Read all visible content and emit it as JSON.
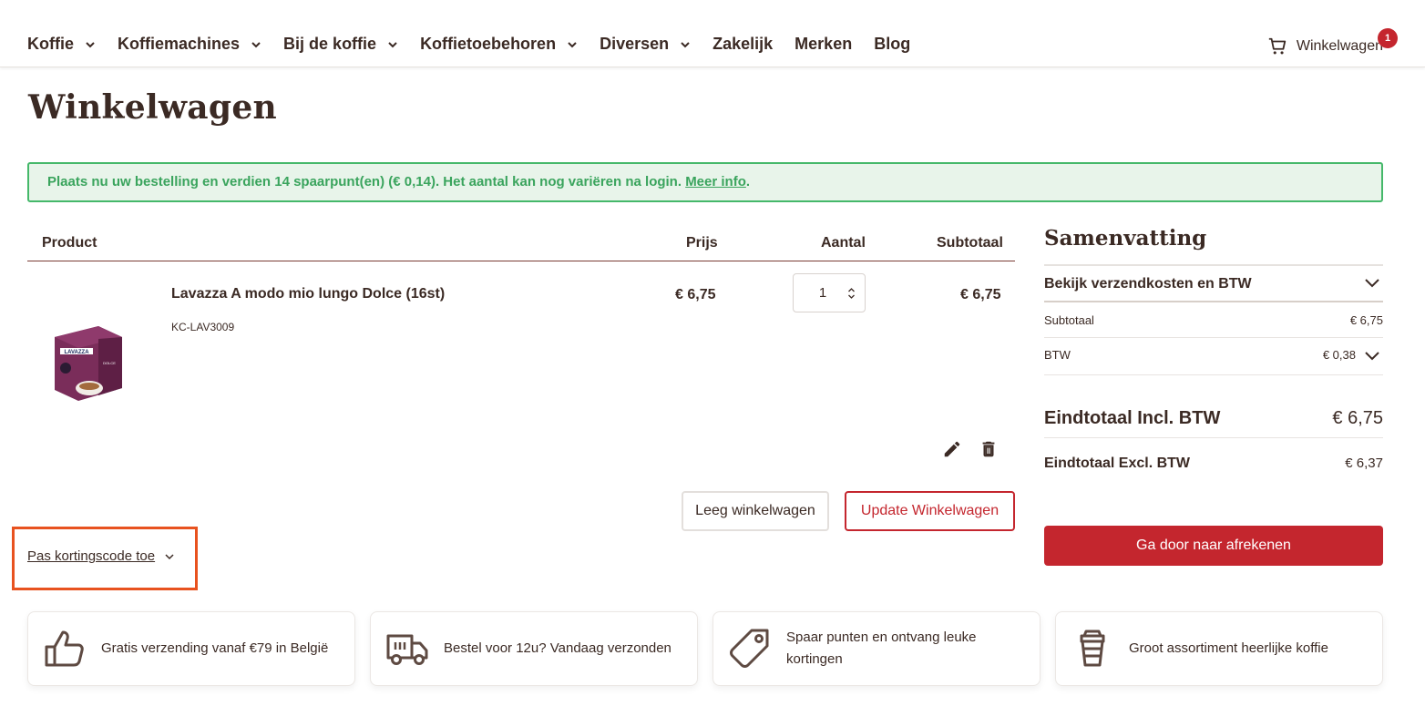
{
  "nav": {
    "items": [
      {
        "label": "Koffie",
        "has_dropdown": true
      },
      {
        "label": "Koffiemachines",
        "has_dropdown": true
      },
      {
        "label": "Bij de koffie",
        "has_dropdown": true
      },
      {
        "label": "Koffietoebehoren",
        "has_dropdown": true
      },
      {
        "label": "Diversen",
        "has_dropdown": true
      },
      {
        "label": "Zakelijk",
        "has_dropdown": false
      },
      {
        "label": "Merken",
        "has_dropdown": false
      },
      {
        "label": "Blog",
        "has_dropdown": false
      }
    ],
    "cart_label": "Winkelwagen",
    "cart_count": "1",
    "cart_icon": "shopping-cart-icon"
  },
  "page": {
    "title": "Winkelwagen"
  },
  "notice": {
    "text": "Plaats nu uw bestelling en verdien 14 spaarpunt(en) (€ 0,14). Het aantal kan nog variëren na login.",
    "link": "Meer info",
    "after": "."
  },
  "table": {
    "headers": {
      "product": "Product",
      "price": "Prijs",
      "qty": "Aantal",
      "subtotal": "Subtotaal"
    },
    "items": [
      {
        "name": "Lavazza A modo mio lungo Dolce (16st)",
        "sku": "KC-LAV3009",
        "price": "€ 6,75",
        "qty": "1",
        "subtotal": "€ 6,75",
        "image_brand": "LAVAZZA",
        "image_variant": "DOLCE"
      }
    ]
  },
  "actions": {
    "clear": "Leeg winkelwagen",
    "update": "Update Winkelwagen",
    "coupon": "Pas kortingscode toe"
  },
  "summary": {
    "title": "Samenvatting",
    "toggle": "Bekijk verzendkosten en BTW",
    "subtotal_label": "Subtotaal",
    "subtotal_value": "€ 6,75",
    "btw_label": "BTW",
    "btw_value": "€ 0,38",
    "total_incl_label": "Eindtotaal Incl. BTW",
    "total_incl_value": "€ 6,75",
    "total_excl_label": "Eindtotaal Excl. BTW",
    "total_excl_value": "€ 6,37",
    "checkout": "Ga door naar afrekenen"
  },
  "usps": [
    {
      "icon": "thumbs-up-icon",
      "text": "Gratis verzending vanaf €79 in België"
    },
    {
      "icon": "delivery-truck-icon",
      "text": "Bestel voor 12u? Vandaag verzonden"
    },
    {
      "icon": "price-tag-icon",
      "text": "Spaar punten en ontvang leuke kortingen"
    },
    {
      "icon": "coffee-cup-icon",
      "text": "Groot assortiment heerlijke koffie"
    }
  ],
  "colors": {
    "brand_red": "#c4262e",
    "text_brown": "#3b2a24",
    "notice_green": "#3aa45d",
    "highlight_orange": "#e8521f"
  }
}
